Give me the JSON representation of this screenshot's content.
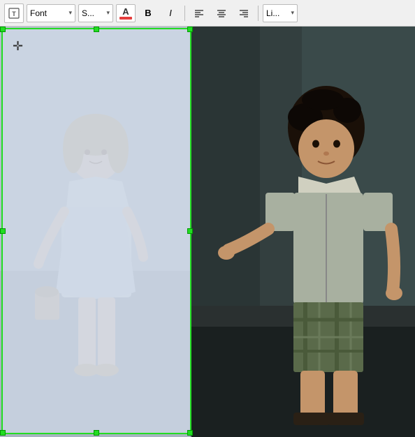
{
  "toolbar": {
    "icon_label": "T",
    "font_label": "Font",
    "font_arrow": "▾",
    "size_label": "S...",
    "size_arrow": "▾",
    "color_label": "A",
    "bold_label": "B",
    "italic_label": "I",
    "align_left": "☰",
    "align_center": "≡",
    "align_right": "≡",
    "lines_label": "Li...",
    "lines_arrow": "▾"
  },
  "canvas": {
    "text_box_placeholder": ""
  }
}
